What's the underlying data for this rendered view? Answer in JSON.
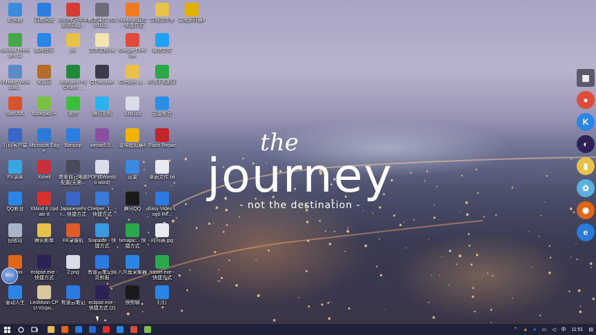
{
  "wallpaper": {
    "quote_the": "the",
    "quote_main": "journey",
    "quote_sub": "- not the destination -"
  },
  "desktop_icons": [
    {
      "label": "此电脑",
      "icon": "computer-icon",
      "color": "#3b8be0"
    },
    {
      "label": "百度网盘",
      "icon": "cloud-icon",
      "color": "#2a7ee0"
    },
    {
      "label": "2019年下半年英语四级...",
      "icon": "pdf-icon",
      "color": "#d33b33"
    },
    {
      "label": "教学课件 20200112...",
      "icon": "file-icon",
      "color": "#6d6d7a"
    },
    {
      "label": "Sunlogin远控 - 快捷方式",
      "icon": "sunlogin-icon",
      "color": "#f07a1c"
    },
    {
      "label": "文档文件夹",
      "icon": "folder-icon",
      "color": "#e8c14b"
    },
    {
      "label": "雷电多开器4",
      "icon": "thunder-icon",
      "color": "#e2b000"
    },
    {
      "label": "Navicat Premium 12",
      "icon": "navicat-icon",
      "color": "#49a64a"
    },
    {
      "label": "酷狗音乐",
      "icon": "kugou-icon",
      "color": "#2a86e6"
    },
    {
      "label": "ps",
      "icon": "folder-icon",
      "color": "#e8c14b"
    },
    {
      "label": "文本文档.txt",
      "icon": "text-icon",
      "color": "#f1e6b0"
    },
    {
      "label": "Google Chrome",
      "icon": "chrome-icon",
      "color": "#dd4b39"
    },
    {
      "label": "微信文件",
      "icon": "app-icon",
      "color": "#1da1f2"
    },
    {
      "label": "VMware Workstati...",
      "icon": "vmware-icon",
      "color": "#5b8bc8"
    },
    {
      "label": "安装云",
      "icon": "app-icon",
      "color": "#b56d2a"
    },
    {
      "label": "JetBrains PyCharm ...",
      "icon": "pycharm-icon",
      "color": "#1e8a3a"
    },
    {
      "label": "QTranslate",
      "icon": "translate-icon",
      "color": "#3a3a4a"
    },
    {
      "label": "Chelper_1...",
      "icon": "folder-icon",
      "color": "#e8c14b"
    },
    {
      "label": "华为手机助手",
      "icon": "phone-icon",
      "color": "#2aa84a"
    },
    {
      "label": "StarUML",
      "icon": "star-icon",
      "color": "#d5532d"
    },
    {
      "label": "Notepad++",
      "icon": "notepad-icon",
      "color": "#7ac143"
    },
    {
      "label": "微信",
      "icon": "wechat-icon",
      "color": "#3bbf3b"
    },
    {
      "label": "腾讯视频",
      "icon": "video-icon",
      "color": "#2bb3f0"
    },
    {
      "label": "1.txt.jpg",
      "icon": "image-icon",
      "color": "#d8dde8"
    },
    {
      "label": "迅雷影音",
      "icon": "player-icon",
      "color": "#2a8fe0"
    },
    {
      "label": "打码客户端",
      "icon": "app-icon",
      "color": "#3a66c8"
    },
    {
      "label": "Microsoft Edge",
      "icon": "edge-icon",
      "color": "#2a7bd8"
    },
    {
      "label": "Bandzip",
      "icon": "zip-icon",
      "color": "#2a7fe0"
    },
    {
      "label": "winrar5.0...",
      "icon": "winrar-icon",
      "color": "#8a4fa0"
    },
    {
      "label": "雷电模拟器4",
      "icon": "emulator-icon",
      "color": "#f0b400"
    },
    {
      "label": "Flash Repair",
      "icon": "flash-icon",
      "color": "#c0262c"
    },
    {
      "label": "FV录屏",
      "icon": "record-icon",
      "color": "#3aa6e0"
    },
    {
      "label": "Xshell",
      "icon": "xshell-icon",
      "color": "#c8303a"
    },
    {
      "label": "查看自己电脑配置(无需...",
      "icon": "info-icon",
      "color": "#4a4a5a"
    },
    {
      "label": "PDF转Word(to word)",
      "icon": "pdf-word-icon",
      "color": "#d8dde8"
    },
    {
      "label": "迅雷",
      "icon": "thunder-icon",
      "color": "#3a8ae0"
    },
    {
      "label": "桌面文件.txt",
      "icon": "text-icon",
      "color": "#e8eaf0"
    },
    {
      "label": "QQ影音",
      "icon": "qqplayer-icon",
      "color": "#2a86e6"
    },
    {
      "label": "XMind 8 Update 8",
      "icon": "xmind-icon",
      "color": "#d8302a"
    },
    {
      "label": "JapaneseFor... 快捷方式",
      "icon": "app-icon",
      "color": "#3a66c8"
    },
    {
      "label": "Chelper_1... - 快捷方式",
      "icon": "app-icon",
      "color": "#3a7ad8"
    },
    {
      "label": "腾讯QQ",
      "icon": "qq-icon",
      "color": "#1a1a1a"
    },
    {
      "label": "Easy Video Logo Re...",
      "icon": "video-icon",
      "color": "#2a7ae0"
    },
    {
      "label": "回收站",
      "icon": "recycle-icon",
      "color": "#a8b4c8"
    },
    {
      "label": "腾讯影库",
      "icon": "folder-icon",
      "color": "#e8c14b"
    },
    {
      "label": "KK录像机",
      "icon": "camera-icon",
      "color": "#e05a2a"
    },
    {
      "label": "Snipaste - 快捷方式",
      "icon": "snipaste-icon",
      "color": "#3a9ae0"
    },
    {
      "label": "txmapic... 快捷方式",
      "icon": "app-icon",
      "color": "#2aa84a"
    },
    {
      "label": "时间表.jpg",
      "icon": "image-icon",
      "color": "#e8eaf0"
    },
    {
      "label": "Firefox",
      "icon": "firefox-icon",
      "color": "#e0661a"
    },
    {
      "label": "eclipse.exe - 快捷方式",
      "icon": "eclipse-icon",
      "color": "#2c2255"
    },
    {
      "label": "2.png",
      "icon": "image-icon",
      "color": "#d8dde8"
    },
    {
      "label": "有道云笔记网页剪报",
      "icon": "note-icon",
      "color": "#2a7ae0"
    },
    {
      "label": "八爪鱼采集器",
      "icon": "spider-icon",
      "color": "#2a86e6"
    },
    {
      "label": "fiddler.exe - 快捷方式",
      "icon": "fiddler-icon",
      "color": "#2aa84a"
    },
    {
      "label": "驱动人生",
      "icon": "driver-icon",
      "color": "#2a86e6"
    },
    {
      "label": "LeoMoon CPU-V(cpu...",
      "icon": "cpu-icon",
      "color": "#d8c89a"
    },
    {
      "label": "有道云笔记",
      "icon": "note-icon",
      "color": "#2a7ae0"
    },
    {
      "label": "eclipse.exe - 快捷方式 (2)",
      "icon": "eclipse-icon",
      "color": "#2c2255"
    },
    {
      "label": "快剪辑",
      "icon": "clip-icon",
      "color": "#1a1a1a"
    },
    {
      "label": "钉钉",
      "icon": "dingtalk-icon",
      "color": "#2a86e6"
    }
  ],
  "dock": [
    {
      "name": "windows-icon",
      "color": "#5a5a6a",
      "glyph": "▦"
    },
    {
      "name": "chrome-icon",
      "color": "#dd4b39",
      "glyph": "●"
    },
    {
      "name": "kugou-icon",
      "color": "#2a86e6",
      "glyph": "K"
    },
    {
      "name": "eclipse-icon",
      "color": "#2c2255",
      "glyph": "◐"
    },
    {
      "name": "folder-icon",
      "color": "#e8c14b",
      "glyph": "▮"
    },
    {
      "name": "pinwheel-icon",
      "color": "#5ab0e0",
      "glyph": "✿"
    },
    {
      "name": "firefox-icon",
      "color": "#e0661a",
      "glyph": "◉"
    },
    {
      "name": "edge-icon",
      "color": "#2a7bd8",
      "glyph": "e"
    }
  ],
  "float_ball": "60.0",
  "taskbar": {
    "apps": [
      {
        "name": "file-explorer-icon",
        "color": "#e8c14b"
      },
      {
        "name": "firefox-icon",
        "color": "#e0661a"
      },
      {
        "name": "edge-icon",
        "color": "#2a7bd8"
      },
      {
        "name": "app-icon",
        "color": "#2a6ad0"
      },
      {
        "name": "netease-music-icon",
        "color": "#d8302a"
      },
      {
        "name": "qq-icon",
        "color": "#2a86e6"
      },
      {
        "name": "chrome-icon",
        "color": "#dd4b39"
      },
      {
        "name": "notepad-icon",
        "color": "#7ac143"
      }
    ],
    "ime": "中",
    "time": "11:51"
  }
}
